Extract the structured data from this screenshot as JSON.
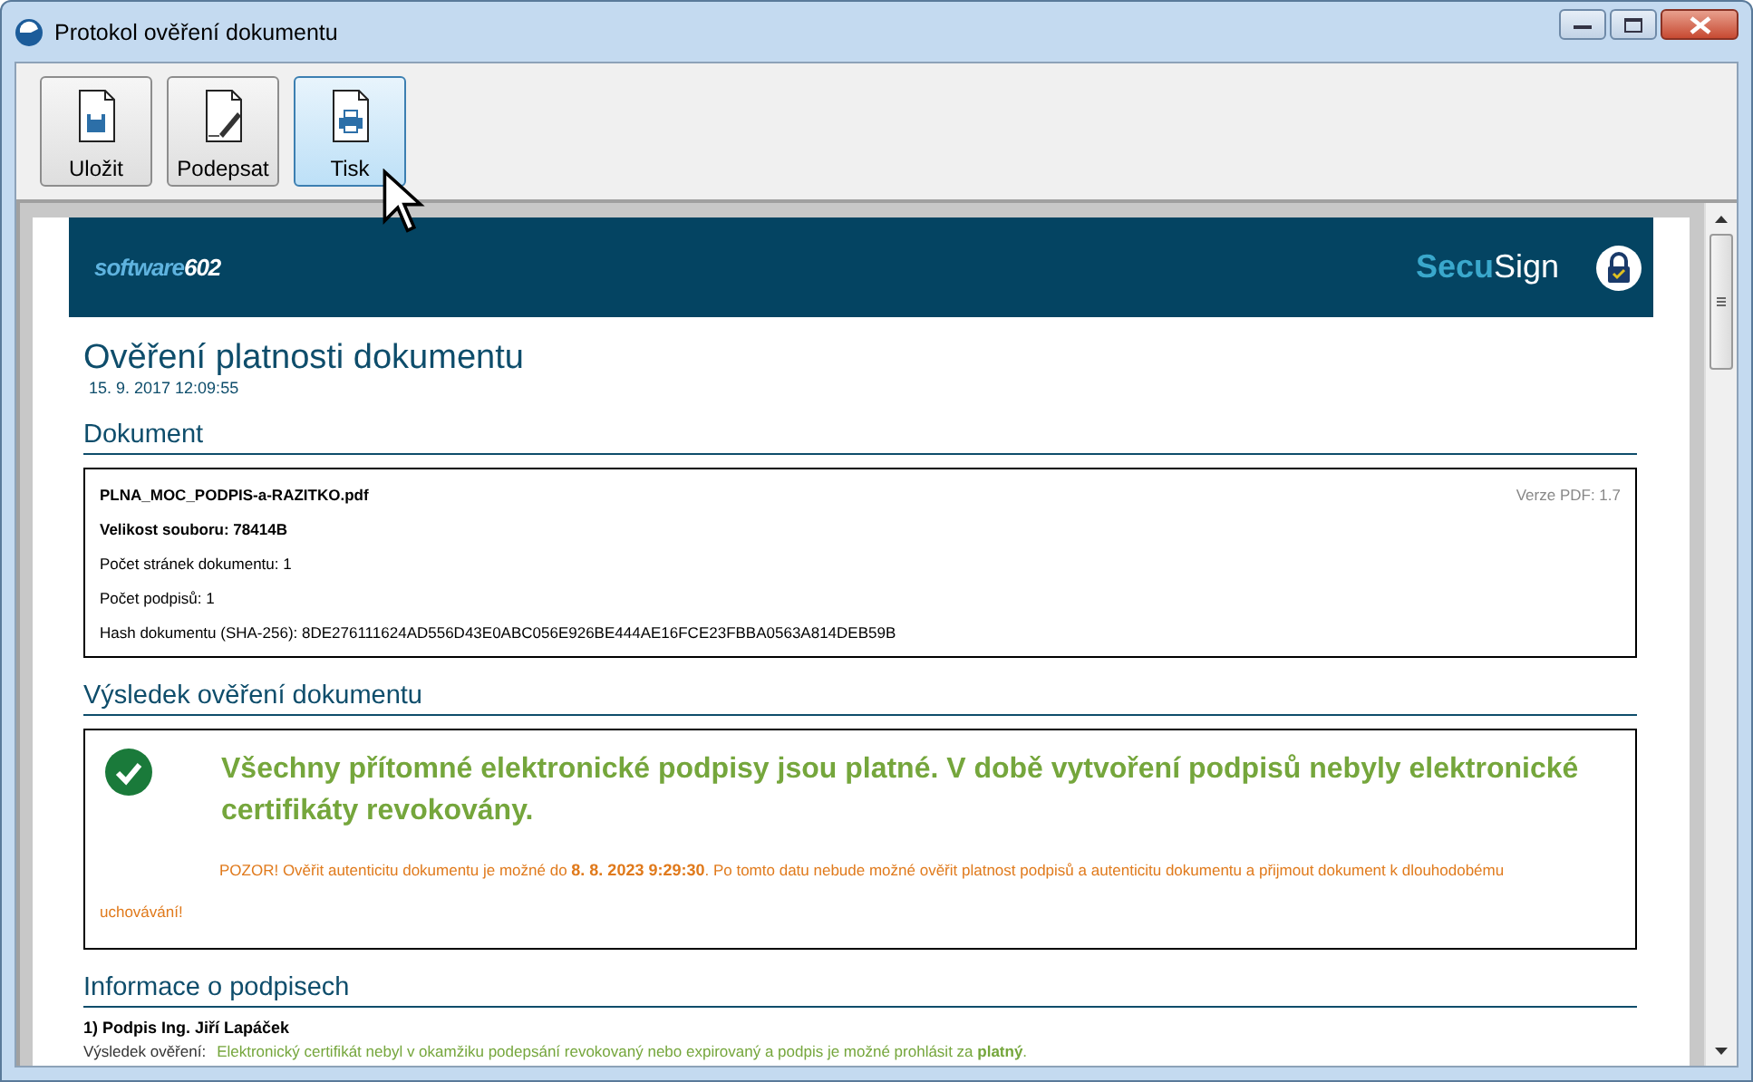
{
  "window": {
    "title": "Protokol ověření dokumentu"
  },
  "toolbar": {
    "buttons": [
      {
        "label": "Uložit",
        "kind": "save",
        "hovered": false
      },
      {
        "label": "Podepsat",
        "kind": "sign",
        "hovered": false
      },
      {
        "label": "Tisk",
        "kind": "print",
        "hovered": true
      }
    ]
  },
  "document": {
    "header": {
      "logo_left": "software**602**",
      "logo_right": "**Secu**Sign"
    },
    "title": "Ověření platnosti dokumentu",
    "date": "15. 9. 2017 12:09:55",
    "document_section": {
      "heading": "Dokument",
      "file_name": "PLNA_MOC_PODPIS-a-RAZITKO.pdf",
      "pdf_version": "Verze PDF: 1.7",
      "rows": [
        {
          "text": "Velikost souboru: 78414B",
          "emphasis": true
        },
        {
          "text": "Počet stránek dokumentu: 1",
          "emphasis": false
        },
        {
          "text": "Počet podpisů: 1",
          "emphasis": false
        },
        {
          "text": "Hash dokumentu (SHA-256): 8DE276111624AD556D43E0ABC056E926BE444AE16FCE23FBBA0563A814DEB59B",
          "emphasis": false
        }
      ]
    },
    "result_section": {
      "heading": "Výsledek ověření dokumentu",
      "valid": true,
      "message": "Všechny přítomné elektronické podpisy jsou platné. V době vytvoření podpisů nebyly elektronické certifikáty revokovány.",
      "warning": "POZOR! Ověřit autenticitu dokumentu je možné do **8. 8. 2023 9:29:30**. Po tomto datu nebude možné ověřit platnost podpisů a autenticitu dokumentu a přijmout dokument k dlouhodobému uchovávání!"
    },
    "signatures_section": {
      "heading": "Informace o podpisech",
      "signatures": [
        {
          "title": "1) Podpis Ing. Jiří Lapáček",
          "label": "Výsledek ověření:",
          "value": "Elektronický certifikát nebyl v okamžiku podepsání revokovaný nebo expirovaný a podpis je možné prohlásit za **platný**."
        }
      ]
    }
  }
}
